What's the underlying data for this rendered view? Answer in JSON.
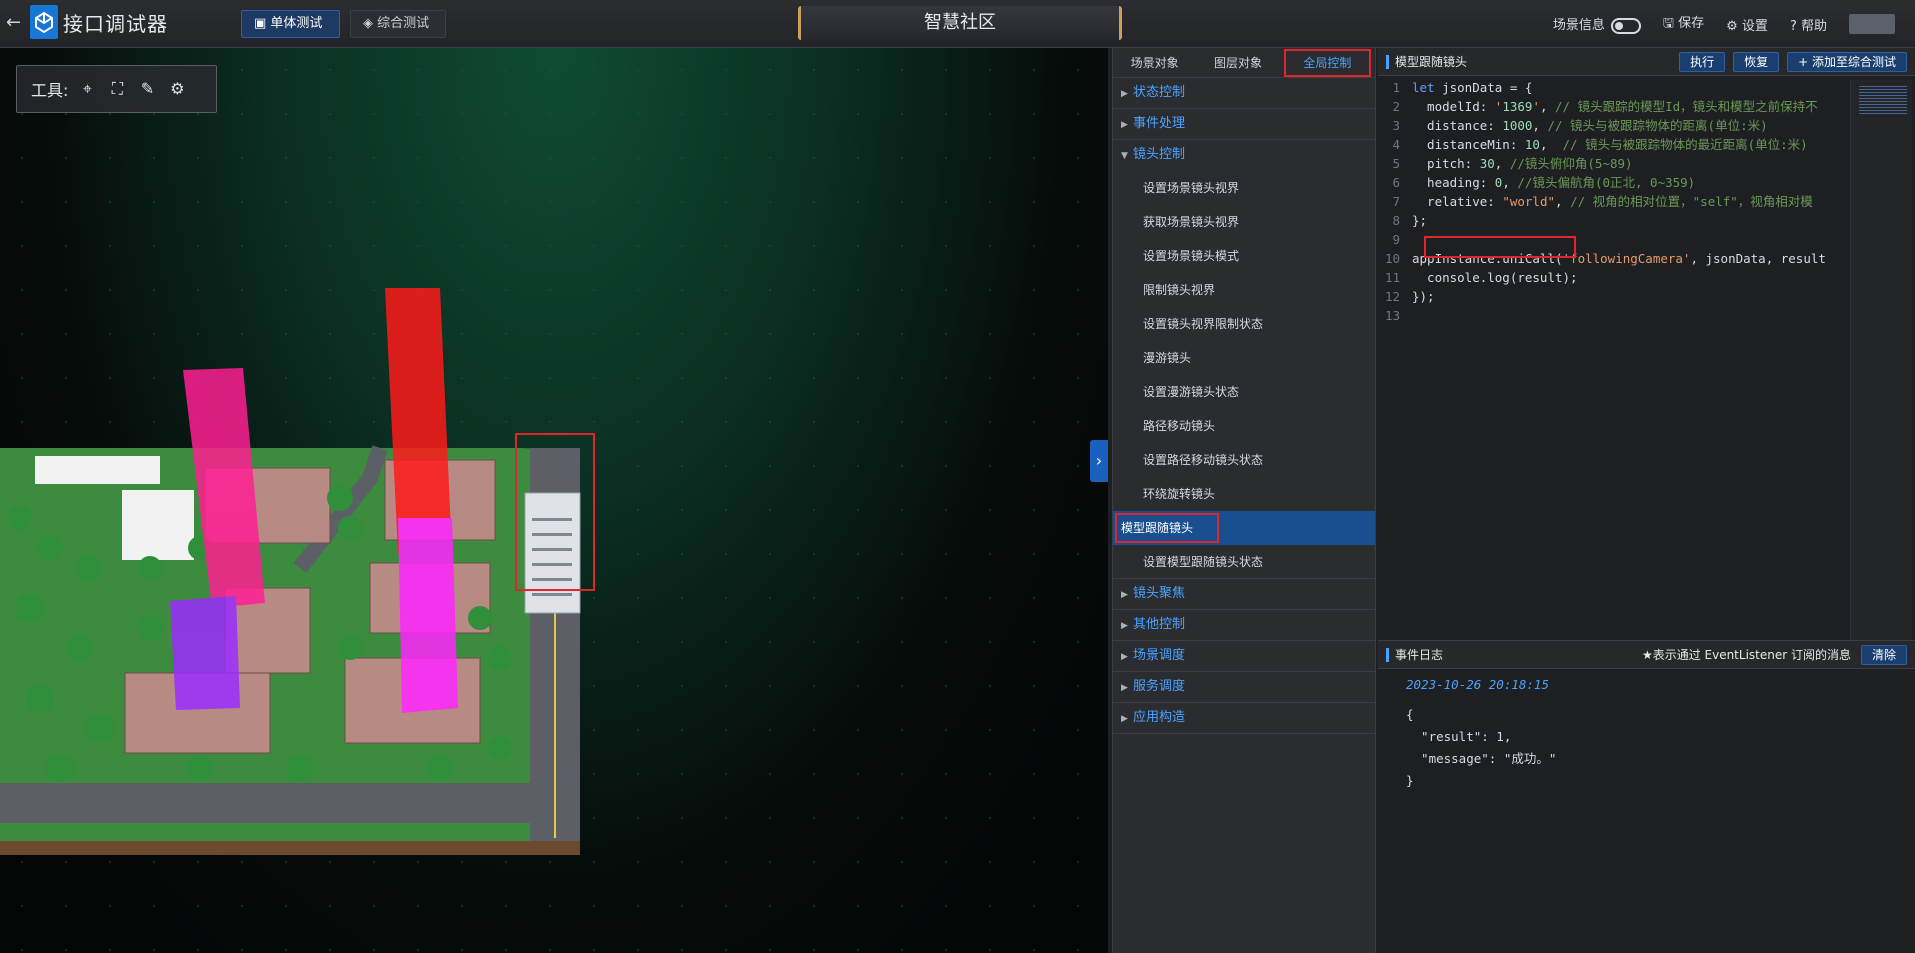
{
  "app": {
    "title": "接口调试器",
    "back": "←"
  },
  "modes": {
    "single": "单体测试",
    "combined": "综合测试"
  },
  "scene_name": "智慧社区",
  "top_right": {
    "scene_info": "场景信息",
    "save": "保存",
    "settings": "设置",
    "help": "帮助"
  },
  "toolbar": {
    "label": "工具:"
  },
  "menu": {
    "tabs": [
      "场景对象",
      "图层对象",
      "全局控制"
    ],
    "categories_top": [
      "状态控制",
      "事件处理",
      "镜头控制"
    ],
    "camera_items": [
      "设置场景镜头视界",
      "获取场景镜头视界",
      "设置场景镜头模式",
      "限制镜头视界",
      "设置镜头视界限制状态",
      "漫游镜头",
      "设置漫游镜头状态",
      "路径移动镜头",
      "设置路径移动镜头状态",
      "环绕旋转镜头",
      "模型跟随镜头",
      "设置模型跟随镜头状态"
    ],
    "categories_bottom": [
      "镜头聚焦",
      "其他控制",
      "场景调度",
      "服务调度",
      "应用构造"
    ]
  },
  "editor": {
    "title": "模型跟随镜头",
    "run": "执行",
    "restore": "恢复",
    "add": "+ 添加至综合测试",
    "lines": [
      "let jsonData = {",
      "  modelId: '1369', // 镜头跟踪的模型Id，镜头和模型之前保持不",
      "  distance: 1000, // 镜头与被跟踪物体的距离(单位:米)",
      "  distanceMin: 10,  // 镜头与被跟踪物体的最近距离(单位:米)",
      "  pitch: 30, //镜头俯仰角(5~89)",
      "  heading: 0, //镜头偏航角(0正北, 0~359)",
      "  relative: \"world\", // 视角的相对位置，\"self\"，视角相对模",
      "};",
      "",
      "appInstance.uniCall('followingCamera', jsonData, result",
      "  console.log(result);",
      "});",
      ""
    ]
  },
  "events": {
    "title": "事件日志",
    "hint": "★表示通过 EventListener 订阅的消息",
    "clear": "清除",
    "time": "2023-10-26 20:18:15",
    "json": [
      "{",
      "  \"result\": 1,",
      "  \"message\": \"成功。\"",
      "}"
    ]
  }
}
